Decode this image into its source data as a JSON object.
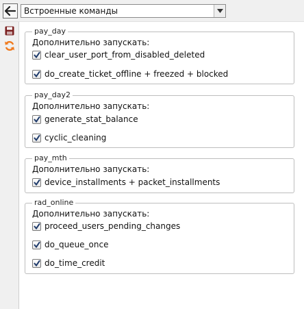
{
  "command_select": {
    "value": "Встроенные команды"
  },
  "icons": {
    "back": "arrow-left-icon",
    "save": "save-icon",
    "refresh": "refresh-icon"
  },
  "colors": {
    "refresh_icon": "#f07a1e",
    "save_icon": "#7a1f1f",
    "checkmark": "#1f3b6b"
  },
  "groups": [
    {
      "title": "pay_day",
      "subtitle": "Дополнительно запускать:",
      "items": [
        {
          "label": "clear_user_port_from_disabled_deleted",
          "checked": true
        },
        {
          "label": "do_create_ticket_offline + freezed + blocked",
          "checked": true
        }
      ]
    },
    {
      "title": "pay_day2",
      "subtitle": "Дополнительно запускать:",
      "items": [
        {
          "label": "generate_stat_balance",
          "checked": true
        },
        {
          "label": "cyclic_cleaning",
          "checked": true
        }
      ]
    },
    {
      "title": "pay_mth",
      "subtitle": "Дополнительно запускать:",
      "items": [
        {
          "label": "device_installments + packet_installments",
          "checked": true
        }
      ]
    },
    {
      "title": "rad_online",
      "subtitle": "Дополнительно запускать:",
      "items": [
        {
          "label": "proceed_users_pending_changes",
          "checked": true
        },
        {
          "label": "do_queue_once",
          "checked": true
        },
        {
          "label": "do_time_credit",
          "checked": true
        }
      ]
    }
  ]
}
